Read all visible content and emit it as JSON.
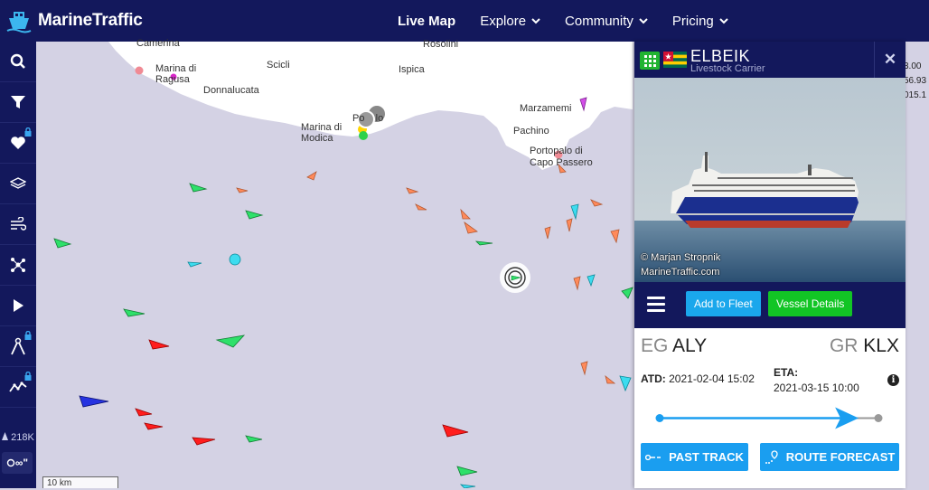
{
  "header": {
    "logo_text": "MarineTraffic",
    "nav": [
      {
        "label": "Live Map",
        "active": true,
        "dropdown": false
      },
      {
        "label": "Explore",
        "active": false,
        "dropdown": true
      },
      {
        "label": "Community",
        "active": false,
        "dropdown": true
      },
      {
        "label": "Pricing",
        "active": false,
        "dropdown": true
      }
    ]
  },
  "sidebar": {
    "buttons": [
      "search-icon",
      "filter-icon",
      "heart-icon",
      "layers-icon",
      "wind-icon",
      "route-icon",
      "play-icon",
      "measure-icon",
      "chart-icon"
    ],
    "vessel_count": "218K",
    "infinity_label": "∞\""
  },
  "map": {
    "labels": {
      "camerina": "Camerina",
      "marina_di_ragusa": "Marina di\nRagusa",
      "scicli": "Scicli",
      "donnalucata": "Donnalucata",
      "rosolini": "Rosolini",
      "ispica": "Ispica",
      "marina_di_modica": "Marina di\nModica",
      "pozzallo": "Po    lo",
      "marzamemi": "Marzamemi",
      "pachino": "Pachino",
      "portopalo": "Portopalo di\nCapo Passero"
    },
    "scale": "10 km",
    "side_numbers": [
      "3.00",
      "56.93",
      "015.1"
    ]
  },
  "vessel": {
    "name": "ELBEIK",
    "type": "Livestock Carrier",
    "photo_credit_1": "© Marjan Stropnik",
    "photo_credit_2": "MarineTraffic.com",
    "add_to_fleet": "Add to Fleet",
    "vessel_details": "Vessel Details",
    "from_country": "EG",
    "from_port": "ALY",
    "to_country": "GR",
    "to_port": "KLX",
    "atd_label": "ATD:",
    "atd_value": "2021-02-04 15:02",
    "eta_label": "ETA:",
    "eta_value": "2021-03-15 10:00",
    "progress": 0.86,
    "past_track": "PAST TRACK",
    "route_forecast": "ROUTE FORECAST"
  },
  "colors": {
    "navy": "#13185c",
    "accent_blue": "#1a9ef0",
    "green": "#12c525",
    "sea": "#d4d2e4",
    "land": "#ffffff"
  }
}
